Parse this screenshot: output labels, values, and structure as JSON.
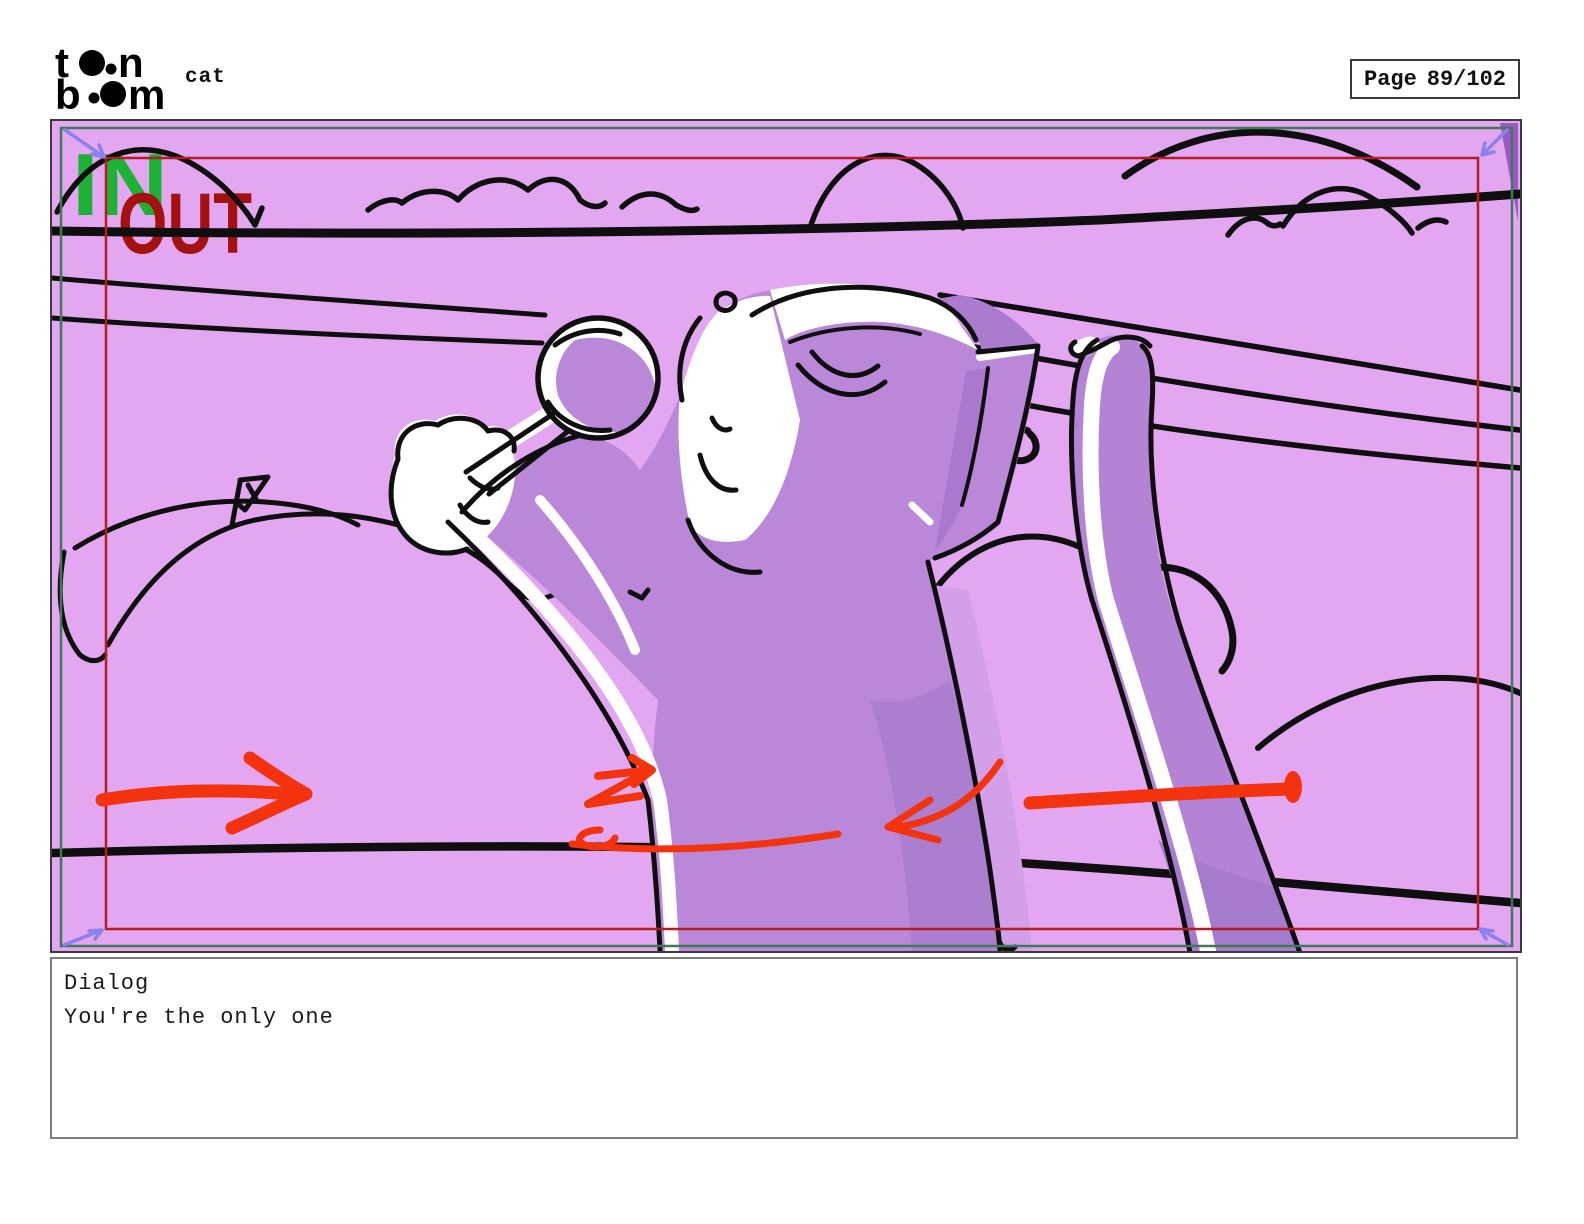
{
  "header": {
    "logo": {
      "name": "toon-boom-logo",
      "l1a": "t",
      "l1b": "n",
      "l2a": "b",
      "l2b": "m",
      "full_text": "toon boom"
    },
    "project_title": "cat",
    "page_label": "Page",
    "page_number": "89/102"
  },
  "panel": {
    "marker_in": "IN",
    "marker_out": "OUT"
  },
  "caption": {
    "label": "Dialog",
    "text": "You're the only one"
  },
  "colors": {
    "panel_background": "#e3a6f0",
    "cat_body": "#bb87d8",
    "cat_shadow": "#ab7ed0",
    "bg_shadow": "#d49fe9",
    "frame_green": "#3d7a55",
    "frame_red": "#b51d23",
    "marker_in_green": "#1db135",
    "marker_out_red": "#a31111",
    "motion_arrow_red": "#f2330d",
    "camera_arrow_purple": "#8d80e8",
    "sketch_black": "#0f0f0f",
    "wisp_gray": "#c8cab6"
  }
}
